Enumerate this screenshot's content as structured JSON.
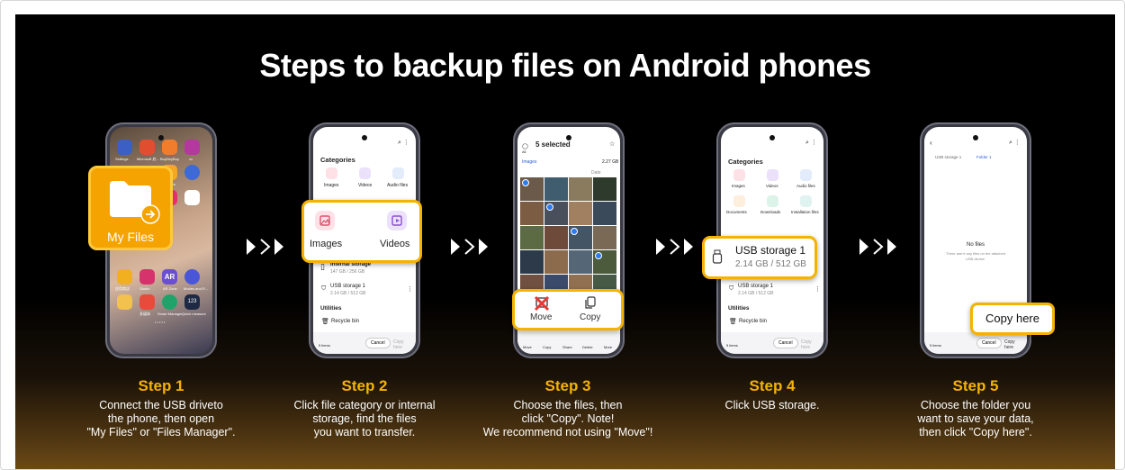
{
  "title": "Steps to backup files on Android phones",
  "colors": {
    "accent": "#f5b300",
    "background": "#000000",
    "text": "#ffffff"
  },
  "phone1": {
    "apps_row1": [
      "Settings",
      "Microsoft 启...",
      "BuyNeyBuy",
      "xx"
    ],
    "myfiles_small": "My Files",
    "callout": "My Files",
    "bottom_row": [
      "应用商店",
      "Studio",
      "AR Zone",
      "Modes and R..."
    ],
    "bottom_row2": [
      "",
      "多媒体",
      "Smart Manager",
      "Quick measure"
    ]
  },
  "phone2": {
    "categories": "Categories",
    "cat_labels": [
      "Images",
      "Videos",
      "Audio files"
    ],
    "callout_images": "Images",
    "callout_videos": "Videos",
    "internal": "Internal storage",
    "internal_size": "147 GB / 256 GB",
    "usb": "USB storage 1",
    "usb_size": "2.14 GB / 512 GB",
    "utilities": "Utilities",
    "recycle": "Recycle bin",
    "cancel": "Cancel",
    "copy_here": "Copy here",
    "items": "5 items"
  },
  "phone3": {
    "selected": "5 selected",
    "all": "All",
    "crumb": "Images",
    "size": "2.27 GB",
    "date": "Date",
    "move": "Move",
    "copy": "Copy",
    "bar": [
      "Move",
      "Copy",
      "Share",
      "Delete",
      "More"
    ]
  },
  "phone4": {
    "categories": "Categories",
    "cat_labels": [
      "Images",
      "Videos",
      "Audio files"
    ],
    "cat_labels2": [
      "Documents",
      "Downloads",
      "Installation files"
    ],
    "callout_usb": "USB storage 1",
    "callout_size": "2.14 GB / 512 GB",
    "usb": "USB storage 1",
    "usb_size": "2.14 GB / 512 GB",
    "utilities": "Utilities",
    "recycle": "Recycle bin",
    "cancel": "Cancel",
    "copy_here": "Copy here",
    "items": "5 items"
  },
  "phone5": {
    "crumb1": "USB storage 1",
    "crumb2": "Folder 1",
    "nofiles": "No files",
    "nofiles_sub1": "There aren't any files on the attached",
    "nofiles_sub2": "USB device.",
    "callout": "Copy here",
    "cancel": "Cancel",
    "copy_here": "Copy here",
    "items": "5 items"
  },
  "steps": [
    {
      "title": "Step 1",
      "lines": [
        "Connect the USB driveto",
        "the phone, then open",
        "\"My Files\" or \"Files Manager\"."
      ]
    },
    {
      "title": "Step 2",
      "lines": [
        "Click file category or internal",
        "storage, find the files",
        "you want to transfer."
      ]
    },
    {
      "title": "Step 3",
      "lines": [
        "Choose the files, then",
        "click \"Copy\". Note!",
        "We recommend not using \"Move\"!"
      ]
    },
    {
      "title": "Step 4",
      "lines": [
        "Click USB storage."
      ]
    },
    {
      "title": "Step 5",
      "lines": [
        "Choose the folder you",
        "want to save your data,",
        "then click \"Copy here\"."
      ]
    }
  ]
}
